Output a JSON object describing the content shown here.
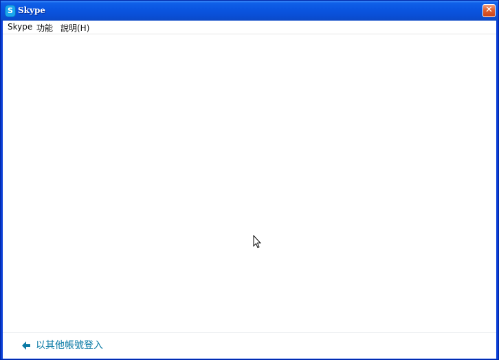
{
  "window": {
    "title": "Skype",
    "icon_glyph": "S",
    "close_glyph": "✕"
  },
  "menu": {
    "items": [
      "Skype",
      "功能",
      "說明(H)"
    ]
  },
  "footer": {
    "back_label": "以其他帳號登入"
  },
  "colors": {
    "titlebar": "#0a55e0",
    "close_button": "#e0602e",
    "link": "#0a7aa5"
  },
  "icons": {
    "app": "skype-icon",
    "close": "close-icon",
    "back": "arrow-left-icon",
    "cursor": "mouse-pointer-icon"
  }
}
